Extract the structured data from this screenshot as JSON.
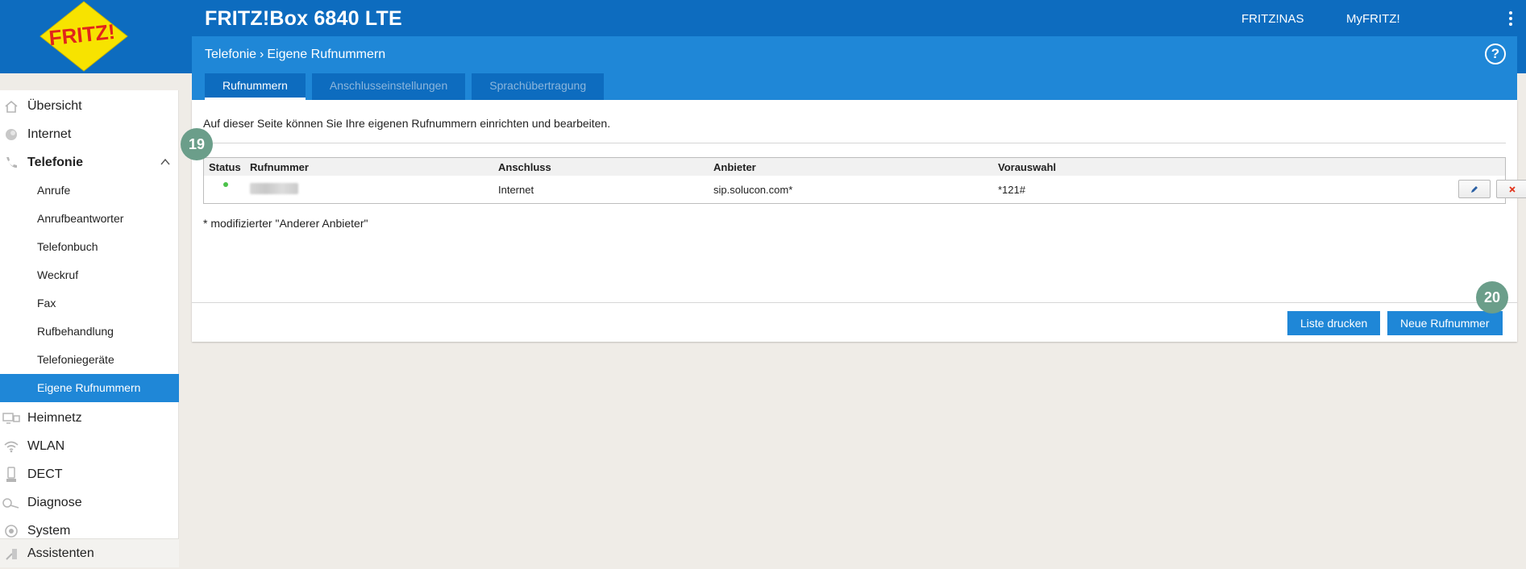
{
  "header": {
    "logo_text": "FRITZ!",
    "device_title": "FRITZ!Box 6840 LTE",
    "links": [
      "FRITZ!NAS",
      "MyFRITZ!"
    ],
    "menu_icon": "kebab-menu-icon"
  },
  "breadcrumb": {
    "parent": "Telefonie",
    "current": "Eigene Rufnummern"
  },
  "help_label": "?",
  "tabs": [
    {
      "label": "Rufnummern",
      "active": true
    },
    {
      "label": "Anschlusseinstellungen",
      "active": false
    },
    {
      "label": "Sprachübertragung",
      "active": false
    }
  ],
  "sidebar": {
    "items": [
      {
        "label": "Übersicht",
        "icon": "home-icon"
      },
      {
        "label": "Internet",
        "icon": "globe-icon"
      },
      {
        "label": "Telefonie",
        "icon": "phone-icon",
        "expanded": true
      },
      {
        "label": "Heimnetz",
        "icon": "network-icon"
      },
      {
        "label": "WLAN",
        "icon": "wifi-icon"
      },
      {
        "label": "DECT",
        "icon": "dect-phone-icon"
      },
      {
        "label": "Diagnose",
        "icon": "diagnose-icon"
      },
      {
        "label": "System",
        "icon": "system-icon"
      },
      {
        "label": "Assistenten",
        "icon": "wizard-icon"
      }
    ],
    "telefonie_sub": [
      {
        "label": "Anrufe"
      },
      {
        "label": "Anrufbeantworter"
      },
      {
        "label": "Telefonbuch"
      },
      {
        "label": "Weckruf"
      },
      {
        "label": "Fax"
      },
      {
        "label": "Rufbehandlung"
      },
      {
        "label": "Telefoniegeräte"
      },
      {
        "label": "Eigene Rufnummern",
        "active": true
      }
    ]
  },
  "content": {
    "intro": "Auf dieser Seite können Sie Ihre eigenen Rufnummern einrichten und bearbeiten.",
    "table": {
      "columns": [
        "Status",
        "Rufnummer",
        "Anschluss",
        "Anbieter",
        "Vorauswahl"
      ],
      "rows": [
        {
          "status": "active",
          "rufnummer": "",
          "anschluss": "Internet",
          "anbieter": "sip.solucon.com*",
          "vorauswahl": "*121#"
        }
      ]
    },
    "footnote": "* modifizierter \"Anderer Anbieter\"",
    "buttons": {
      "print": "Liste drucken",
      "new": "Neue Rufnummer"
    }
  },
  "markers": [
    "19",
    "20"
  ],
  "colors": {
    "header_blue": "#0d6cbf",
    "accent_blue": "#1f87d7",
    "status_green": "#4cc24a",
    "delete_red": "#e1331b",
    "marker_green": "#6b9e8a",
    "background": "#efece7"
  }
}
